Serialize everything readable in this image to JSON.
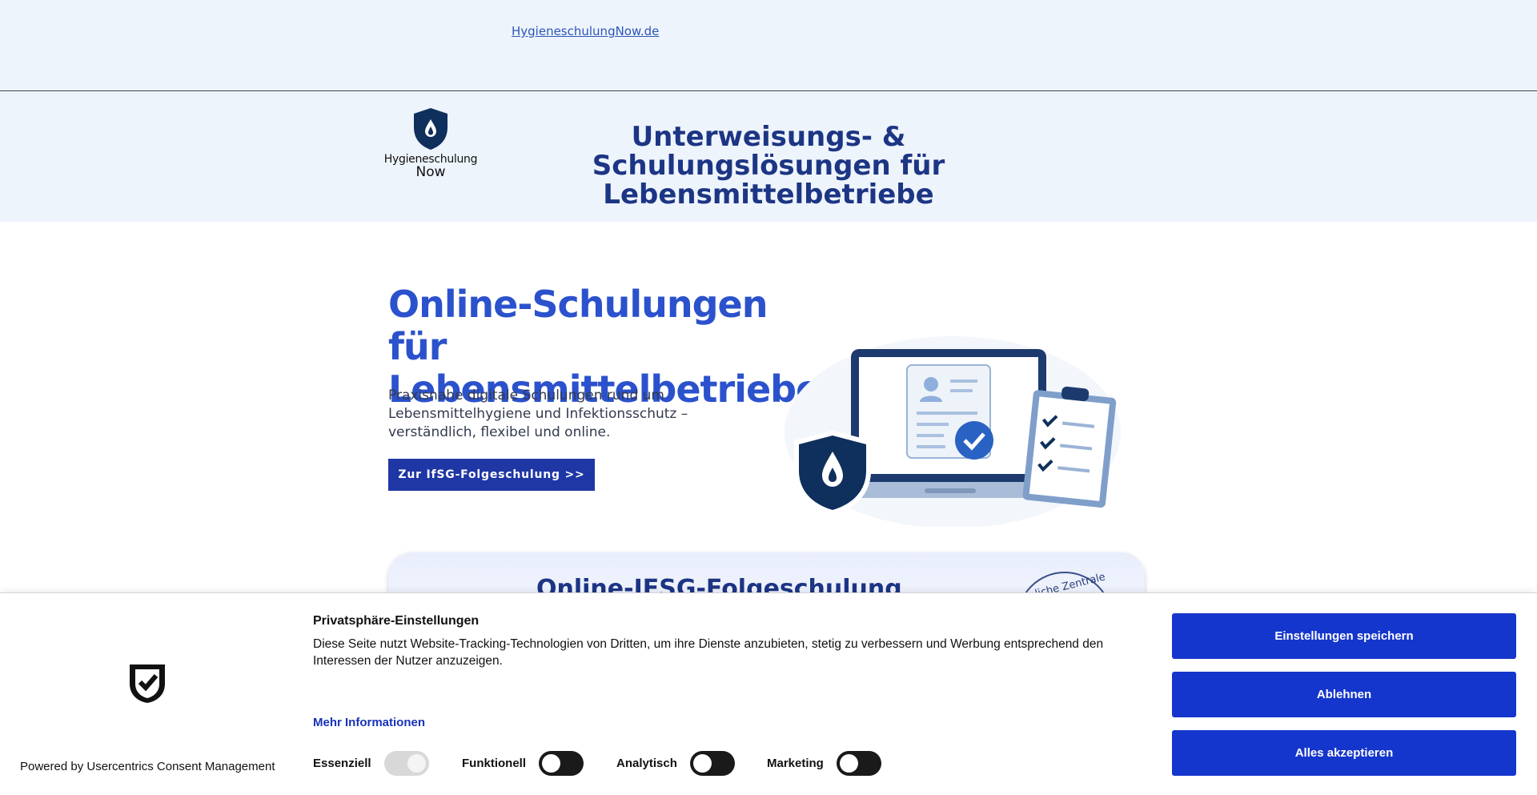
{
  "topbar": {
    "link": "HygieneschulungNow.de"
  },
  "header": {
    "logo_line1": "Hygieneschulung",
    "logo_line2": "Now",
    "title": "Unterweisungs- & Schulungslösungen für Lebensmittelbetriebe"
  },
  "hero": {
    "title": "Online-Schulungen für Lebensmittelbetriebe",
    "text": "Praxisnahe digitale Schulungen rund um Lebensmittelhygiene und Infektionsschutz – verständlich, flexibel und online.",
    "button": "Zur IfSG-Folgeschulung >>"
  },
  "card": {
    "title": "Online-IFSG-Folgeschulung",
    "seal_text": "liche Zentrale"
  },
  "consent": {
    "title": "Privatsphäre-Einstellungen",
    "description": "Diese Seite nutzt Website-Tracking-Technologien von Dritten, um ihre Dienste anzubieten, stetig zu verbessern und Werbung entsprechend den Interessen der Nutzer anzuzeigen.",
    "more_info": "Mehr Informationen",
    "powered_by": "Powered by Usercentrics Consent Management",
    "toggles": [
      {
        "label": "Essenziell",
        "state": "on-disabled"
      },
      {
        "label": "Funktionell",
        "state": "off"
      },
      {
        "label": "Analytisch",
        "state": "off"
      },
      {
        "label": "Marketing",
        "state": "off"
      }
    ],
    "buttons": {
      "save": "Einstellungen speichern",
      "deny": "Ablehnen",
      "accept_all": "Alles akzeptieren"
    }
  },
  "colors": {
    "brand_dark": "#1c3584",
    "brand_blue": "#2b52cc",
    "button_blue": "#1536cc",
    "light_bg": "#eef4fc"
  }
}
